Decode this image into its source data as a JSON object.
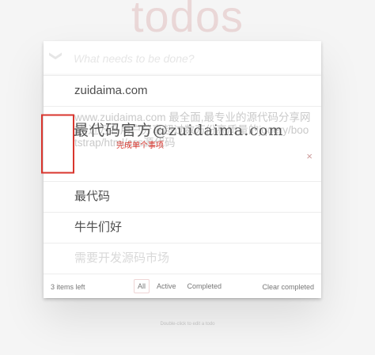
{
  "app": {
    "title": "todos"
  },
  "header": {
    "toggle_all_glyph": "❯",
    "new_todo_placeholder": "What needs to be done?"
  },
  "todos": [
    {
      "text": "zuidaima.com",
      "state": "active"
    },
    {
      "text": "www.zuidaima.com 最全面,最专业的源代码分享网站,近万名用户分享超过数万份高质量的jquery/bootstrap/html/css源代码",
      "state": "editing"
    },
    {
      "text": "最代码",
      "state": "active"
    },
    {
      "text": "牛牛们好",
      "state": "active"
    },
    {
      "text": "需要开发源码市场",
      "state": "completed"
    }
  ],
  "overlay": {
    "check_hint": "完成单个事项",
    "destroy_glyph": "×",
    "watermark": "最代码官方@zuidaima.com"
  },
  "footer": {
    "count": "3 items left",
    "filters": [
      "All",
      "Active",
      "Completed"
    ],
    "selected_filter": "All",
    "clear_label": "Clear completed"
  },
  "info": {
    "text": "Double-click to edit a todo"
  },
  "colors": {
    "title": "#af2f2f",
    "highlight_border": "#d9362e"
  }
}
